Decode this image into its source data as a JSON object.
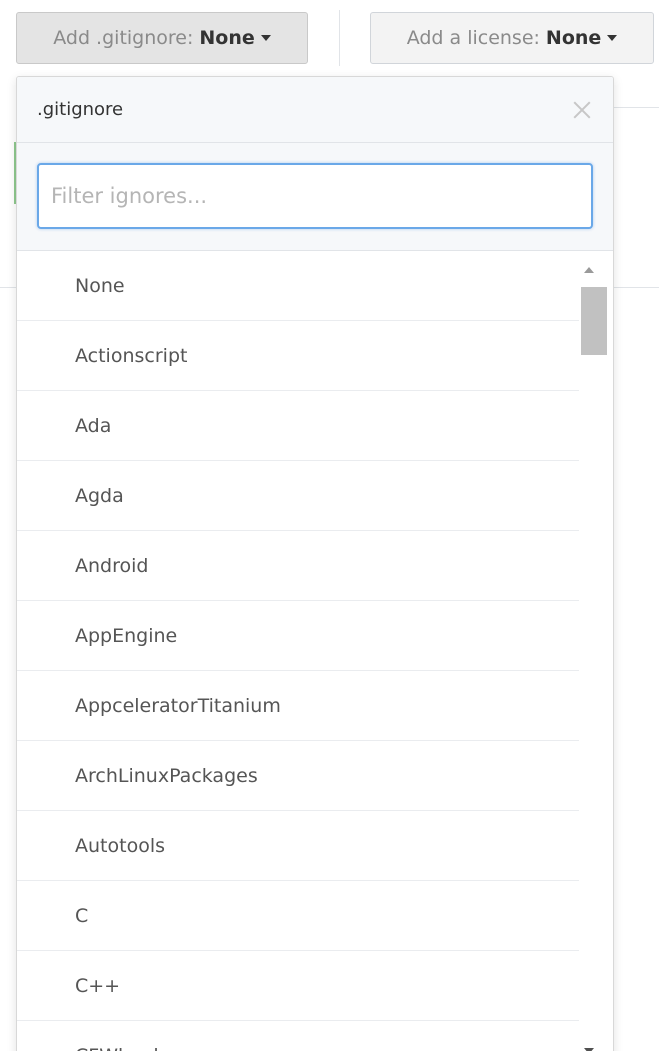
{
  "gitignore_button": {
    "prefix": "Add .gitignore:",
    "value": "None"
  },
  "license_button": {
    "prefix": "Add a license:",
    "value": "None"
  },
  "dropdown": {
    "title": ".gitignore",
    "filter_placeholder": "Filter ignores...",
    "filter_value": "",
    "items": [
      "None",
      "Actionscript",
      "Ada",
      "Agda",
      "Android",
      "AppEngine",
      "AppceleratorTitanium",
      "ArchLinuxPackages",
      "Autotools",
      "C",
      "C++",
      "CFWheels"
    ]
  },
  "icons": {
    "close": "close-icon",
    "caret": "caret-down-icon",
    "scroll_up": "scroll-up-arrow-icon",
    "scroll_down": "scroll-down-arrow-icon"
  },
  "colors": {
    "focus_border": "#6aa8e8",
    "header_bg": "#f6f8fa",
    "item_text": "#555555"
  }
}
